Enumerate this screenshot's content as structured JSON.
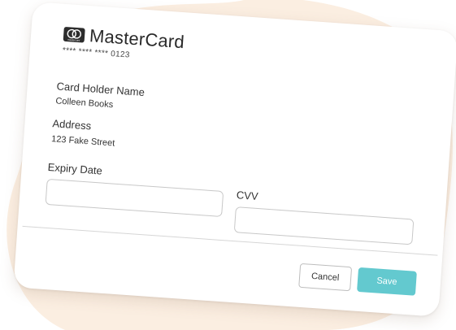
{
  "card": {
    "brand": "MasterCard",
    "logo_text": "mastercard",
    "masked_number": "**** **** **** 0123"
  },
  "fields": {
    "holder": {
      "label": "Card Holder Name",
      "value": "Colleen Books"
    },
    "address": {
      "label": "Address",
      "value": "123 Fake Street"
    },
    "expiry": {
      "label": "Expiry Date",
      "value": ""
    },
    "cvv": {
      "label": "CVV",
      "value": ""
    }
  },
  "actions": {
    "cancel_label": "Cancel",
    "save_label": "Save"
  },
  "colors": {
    "background_blob": "#fbeee1",
    "accent": "#63c9cf",
    "logo": "#2c2c2c"
  },
  "icons": {
    "brand_logo": "mastercard-logo-icon"
  }
}
